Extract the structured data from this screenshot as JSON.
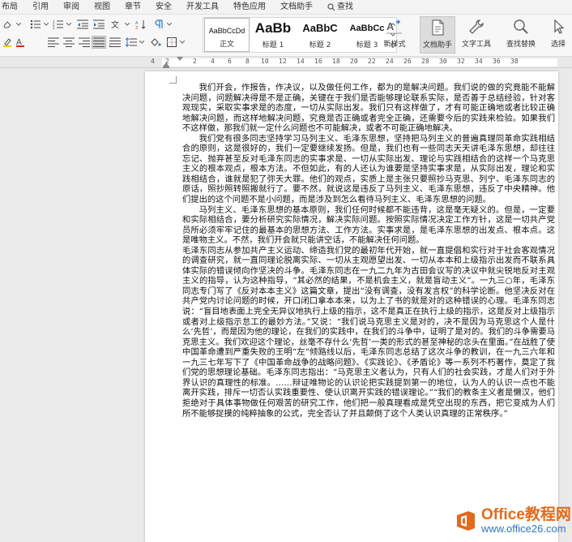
{
  "menu": {
    "tabs": [
      "布局",
      "引用",
      "审阅",
      "视图",
      "章节",
      "安全",
      "开发工具",
      "特色应用",
      "文档助手"
    ],
    "search_label": "查找"
  },
  "ribbon": {
    "styles": [
      {
        "sample": "AaBbCcDd",
        "label": "正文"
      },
      {
        "sample": "AaBb",
        "label": "标题 1"
      },
      {
        "sample": "AaBbC",
        "label": "标题 2"
      },
      {
        "sample": "AaBbCc",
        "label": "标题 3"
      }
    ],
    "new_style_label": "新样式",
    "doc_helper_label": "文档助手",
    "text_tool_label": "文字工具",
    "find_replace_label": "查找替换",
    "select_label": "选择"
  },
  "ruler": {
    "numbers": [
      "4",
      "2",
      "2",
      "4",
      "6",
      "8",
      "10",
      "12",
      "14",
      "16",
      "18",
      "20",
      "22",
      "24",
      "26",
      "28",
      "30",
      "32",
      "34",
      "36",
      "38"
    ]
  },
  "document": {
    "paragraphs": [
      {
        "indent": true,
        "text": "我们开会，作报告，作决议，以及做任何工作，都为的是解决问题。我们说的做的究竟能不能解决问题，问题解决得是不是正确，关键在于我们是否能够理论联系实际，是否善于总结经验，针对客观现实，采取实事求是的态度，一切从实际出发。我们只有这样做了，才有可能正确地或者比较正确地解决问题，而这样地解决问题，究竟是否正确或者完全正确，还需要今后的实践来检验。如果我们不这样做，那我们就一定什么问题也不可能解决，或者不可能正确地解决。"
      },
      {
        "indent": true,
        "text": "我们党有很多同志坚持学习马列主义、毛泽东思想，坚持把马列主义的普遍真理同革命实践相结合的原则，这是很好的，我们一定要继续发扬。但是，我们也有一些同志天天讲毛泽东思想，却往往忘记、抛弃甚至反对毛泽东同志的实事求是、一切从实际出发、理论与实践相结合的这样一个马克思主义的根本观点，根本方法。不但如此，有的人还认为谁要是坚持实事求是，从实际出发，理论和实践相结合，谁就是犯了弥天大罪。他们的观点，实质上是主张只要照抄马克思、列宁、毛泽东同志的原话，照抄照转照搬就行了。要不然，就说这是违反了马列主义、毛泽东思想，违反了中央精神。他们提出的这个问题不是小问题，而是涉及到怎么看待马列主义、毛泽东思想的问题。"
      },
      {
        "indent": true,
        "text": "马列主义、毛泽东思想的基本原则，我们任何时候都不能违背，这是毫无疑义的。但是，一定要和实际相结合，要分析研究实际情况，解决实际问题。按照实际情况决定工作方针，这是一切共产党员所必须牢牢记住的最基本的思想方法、工作方法。实事求是，是毛泽东思想的出发点、根本点。这是唯物主义。不然，我们开会就只能讲空话，不能解决任何问题。"
      },
      {
        "indent": false,
        "text": "毛泽东同志从参加共产主义运动、缔造我们党的最初年代开始，就一直提倡和实行对于社会客观情况的调查研究，就一直同理论脱离实际、一切从主观愿望出发、一切从本本和上级指示出发而不联系具体实际的错误倾向作坚决的斗争。毛泽东同志在一九二九年为古田会议写的决议中就尖锐地反对主观主义的指导，认为这种指导，“其必然的结果，不是机会主义，就是盲动主义”。一九三○年，毛泽东同志专门写了《反对本本主义》这篇文章，提出“没有调查，没有发言权”的科学论断。他坚决反对在共产党内讨论问题的时候，开口闭口拿本本来，以为上了书的就是对的这种错误的心理。毛泽东同志说：“盲目地表面上完全无异议地执行上级的指示，这不是真正在执行上级的指示，这是反对上级指示或者对上级指示怠工的最妙方法。”又说：“我们说马克思主义是对的，决不是因为马克思这个人是什么‘先哲’，而是因为他的理论，在我们的实践中，在我们的斗争中，证明了是对的。我们的斗争需要马克思主义。我们欢迎这个理论，丝毫不存什么‘先哲’一类的形式的甚至神秘的念头在里面。”在战胜了使中国革命遭到严重失败的王明“左”倾路线以后，毛泽东同志总结了这次斗争的教训，在一九三六年和一九三七年写下了《中国革命战争的战略问题》、《实践论》、《矛盾论》等一系列不朽著作，奠定了我们党的思想理论基础。毛泽东同志指出：“马克思主义者认为，只有人们的社会实践，才是人们对于外界认识的真理性的标准。……辩证唯物论的认识论把实践提到第一的地位，认为人的认识一点也不能离开实践，排斥一切否认实践重要性、使认识离开实践的错误理论。”“我们的教条主义者是懒汉，他们拒绝对于具体事物做任何艰苦的研究工作，他们把一般真理看成是凭空出现的东西，把它变成为人们所不能够捉摸的纯粹抽象的公式，完全否认了并且颠倒了这个人类认识真理的正常秩序。”"
      }
    ]
  },
  "watermark": {
    "title": "Office教程网",
    "url": "www.office26.com"
  },
  "colors": {
    "accent": "#2f74c9",
    "watermark_orange": "#e26b1c",
    "ribbon_bg": "#f7f7f7"
  }
}
